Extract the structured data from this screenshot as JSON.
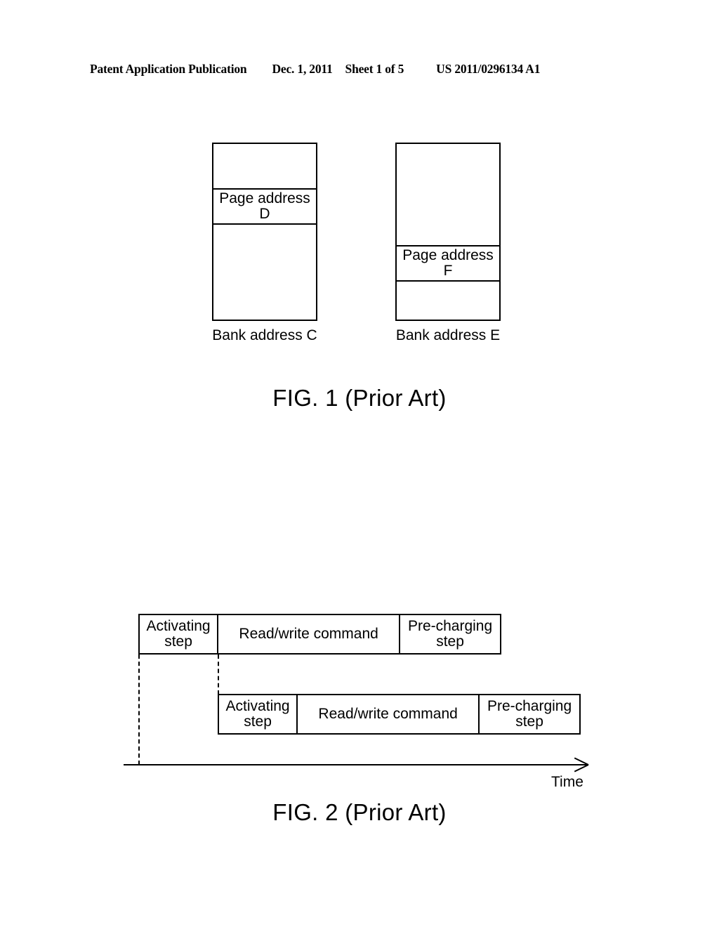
{
  "header": {
    "publication": "Patent Application Publication",
    "date": "Dec. 1, 2011",
    "sheet": "Sheet 1 of 5",
    "patent_number": "US 2011/0296134 A1"
  },
  "figure1": {
    "caption": "FIG. 1 (Prior Art)",
    "banks": [
      {
        "page_band_label_line1": "Page address",
        "page_band_label_line2": "D",
        "bank_caption": "Bank address C"
      },
      {
        "page_band_label_line1": "Page address",
        "page_band_label_line2": "F",
        "bank_caption": "Bank address E"
      }
    ]
  },
  "figure2": {
    "caption": "FIG. 2 (Prior Art)",
    "axis_label": "Time",
    "rows": [
      {
        "cells": [
          {
            "line1": "Activating",
            "line2": "step"
          },
          {
            "line1": "Read/write command",
            "line2": ""
          },
          {
            "line1": "Pre-charging",
            "line2": "step"
          }
        ]
      },
      {
        "cells": [
          {
            "line1": "Activating",
            "line2": "step"
          },
          {
            "line1": "Read/write command",
            "line2": ""
          },
          {
            "line1": "Pre-charging",
            "line2": "step"
          }
        ]
      }
    ]
  },
  "colors": {
    "ink": "#000000",
    "paper": "#ffffff"
  }
}
